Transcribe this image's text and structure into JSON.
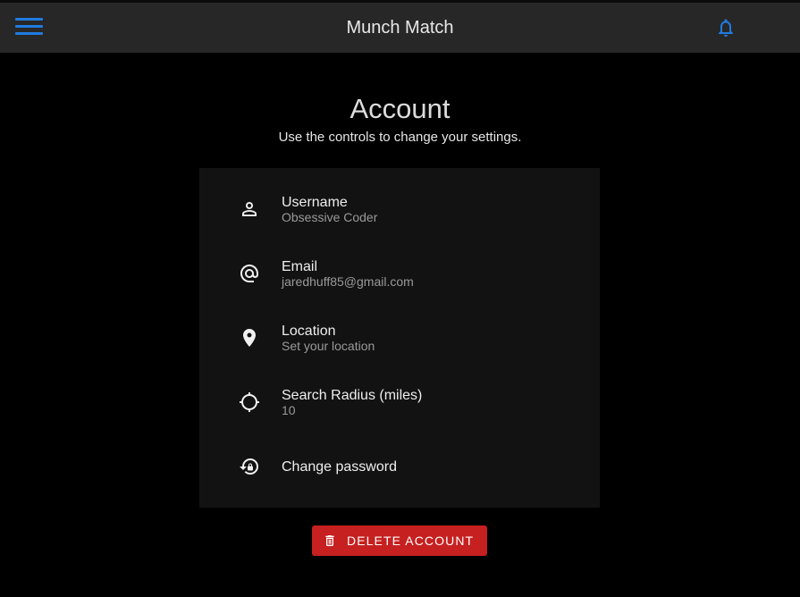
{
  "appbar": {
    "title": "Munch Match",
    "menu_icon": "hamburger-menu-icon",
    "notification_icon": "bell-icon",
    "accent_color": "#1f7be0"
  },
  "page": {
    "title": "Account",
    "subtitle": "Use the controls to change your settings."
  },
  "settings": [
    {
      "icon": "person-icon",
      "label": "Username",
      "value": "Obsessive Coder"
    },
    {
      "icon": "at-sign-icon",
      "label": "Email",
      "value": "jaredhuff85@gmail.com"
    },
    {
      "icon": "location-pin-icon",
      "label": "Location",
      "value": "Set your location"
    },
    {
      "icon": "crosshair-icon",
      "label": "Search Radius (miles)",
      "value": "10"
    },
    {
      "icon": "lock-reset-icon",
      "label": "Change password"
    }
  ],
  "delete_button": {
    "label": "DELETE ACCOUNT",
    "icon": "trash-icon",
    "color": "#c62020"
  }
}
